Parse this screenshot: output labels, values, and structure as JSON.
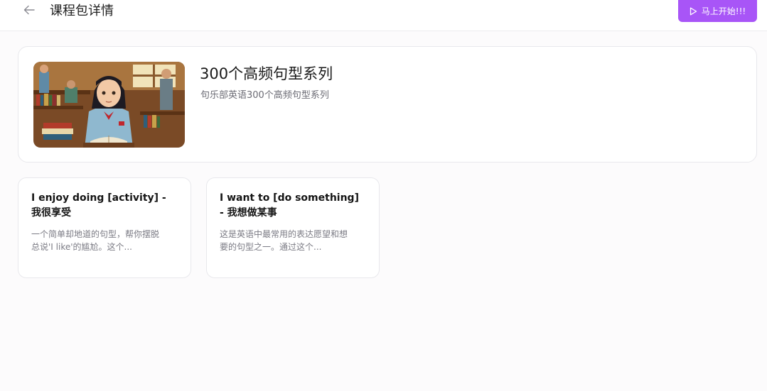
{
  "header": {
    "title": "课程包详情",
    "start_label": "马上开始!!!"
  },
  "course": {
    "title": "300个高频句型系列",
    "subtitle": "句乐部英语300个高频句型系列"
  },
  "lessons": [
    {
      "title": "I enjoy doing [activity] - 我很享受",
      "desc": "一个简单却地道的句型，帮你摆脱总说'I like'的尴尬。这个..."
    },
    {
      "title": "I want to [do something] - 我想做某事",
      "desc": "这是英语中最常用的表达愿望和想要的句型之一。通过这个..."
    }
  ],
  "colors": {
    "accent": "#a855f7",
    "background": "#fcfbfc"
  }
}
